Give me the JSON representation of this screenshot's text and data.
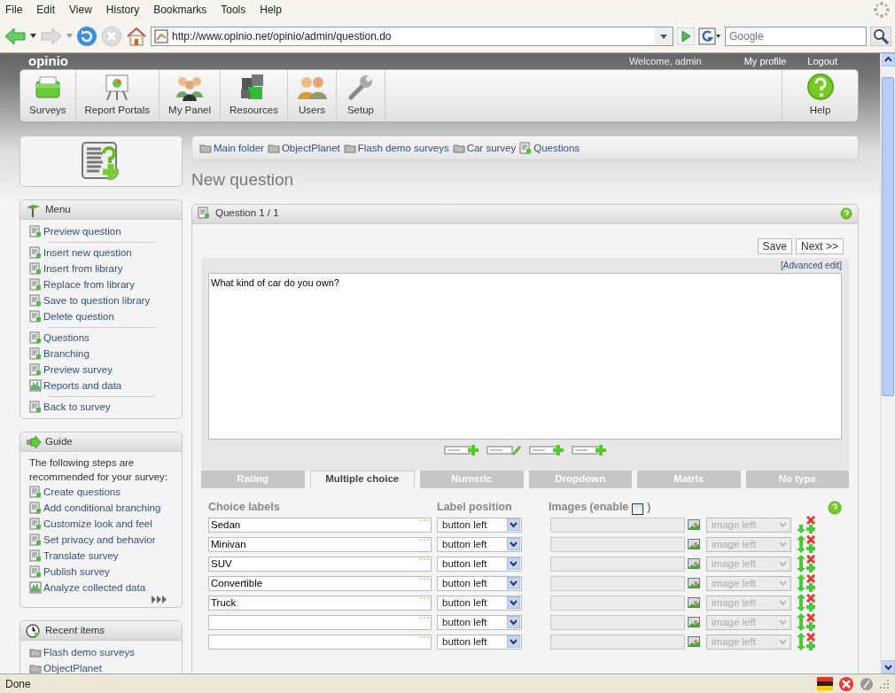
{
  "browser": {
    "menu": [
      "File",
      "Edit",
      "View",
      "History",
      "Bookmarks",
      "Tools",
      "Help"
    ],
    "url": "http://www.opinio.net/opinio/admin/question.do",
    "search_placeholder": "Google",
    "status": "Done"
  },
  "header": {
    "brand": "opinio",
    "welcome": "Welcome, admin",
    "links": [
      "My profile",
      "Logout"
    ]
  },
  "nav": {
    "items": [
      "Surveys",
      "Report Portals",
      "My Panel",
      "Resources",
      "Users",
      "Setup"
    ],
    "help": "Help"
  },
  "menu": {
    "title": "Menu",
    "groups": [
      [
        "Preview question"
      ],
      [
        "Insert new question",
        "Insert from library",
        "Replace from library",
        "Save to question library",
        "Delete question"
      ],
      [
        "Questions",
        "Branching",
        "Preview survey",
        "Reports and data"
      ],
      [
        "Back to survey"
      ]
    ]
  },
  "guide": {
    "title": "Guide",
    "intro": "The following steps are recommended for your survey:",
    "items": [
      "Create questions",
      "Add conditional branching",
      "Customize look and feel",
      "Set privacy and behavior",
      "Translate survey",
      "Publish survey",
      "Analyze collected data"
    ]
  },
  "recent": {
    "title": "Recent items",
    "items": [
      "Flash demo surveys",
      "ObjectPlanet"
    ]
  },
  "breadcrumb": [
    "Main folder",
    "ObjectPlanet",
    "Flash demo surveys",
    "Car survey",
    "Questions"
  ],
  "page_title": "New question",
  "panel": {
    "title": "Question 1 / 1",
    "buttons": [
      "Save",
      "Next >>"
    ],
    "advanced_edit": "[Advanced edit]",
    "question_text": "What kind of car do you own?"
  },
  "tabs": [
    {
      "label": "Rating",
      "selected": false
    },
    {
      "label": "Multiple choice",
      "selected": true
    },
    {
      "label": "Numeric",
      "selected": false
    },
    {
      "label": "Dropdown",
      "selected": false
    },
    {
      "label": "Matrix",
      "selected": false
    },
    {
      "label": "No type",
      "selected": false
    }
  ],
  "columns": {
    "labels": "Choice labels",
    "position": "Label position",
    "images": "Images (enable",
    "images_close": ")"
  },
  "images": {
    "enabled": false
  },
  "choices": [
    {
      "label": "Sedan",
      "position": "button left",
      "image_position": "image left",
      "can_move_up": false
    },
    {
      "label": "Minivan",
      "position": "button left",
      "image_position": "image left",
      "can_move_up": true
    },
    {
      "label": "SUV",
      "position": "button left",
      "image_position": "image left",
      "can_move_up": true
    },
    {
      "label": "Convertible",
      "position": "button left",
      "image_position": "image left",
      "can_move_up": true
    },
    {
      "label": "Truck",
      "position": "button left",
      "image_position": "image left",
      "can_move_up": true
    },
    {
      "position": "button left",
      "image_position": "image left",
      "can_move_up": true
    },
    {
      "position": "button left",
      "image_position": "image left",
      "can_move_up": true
    }
  ]
}
